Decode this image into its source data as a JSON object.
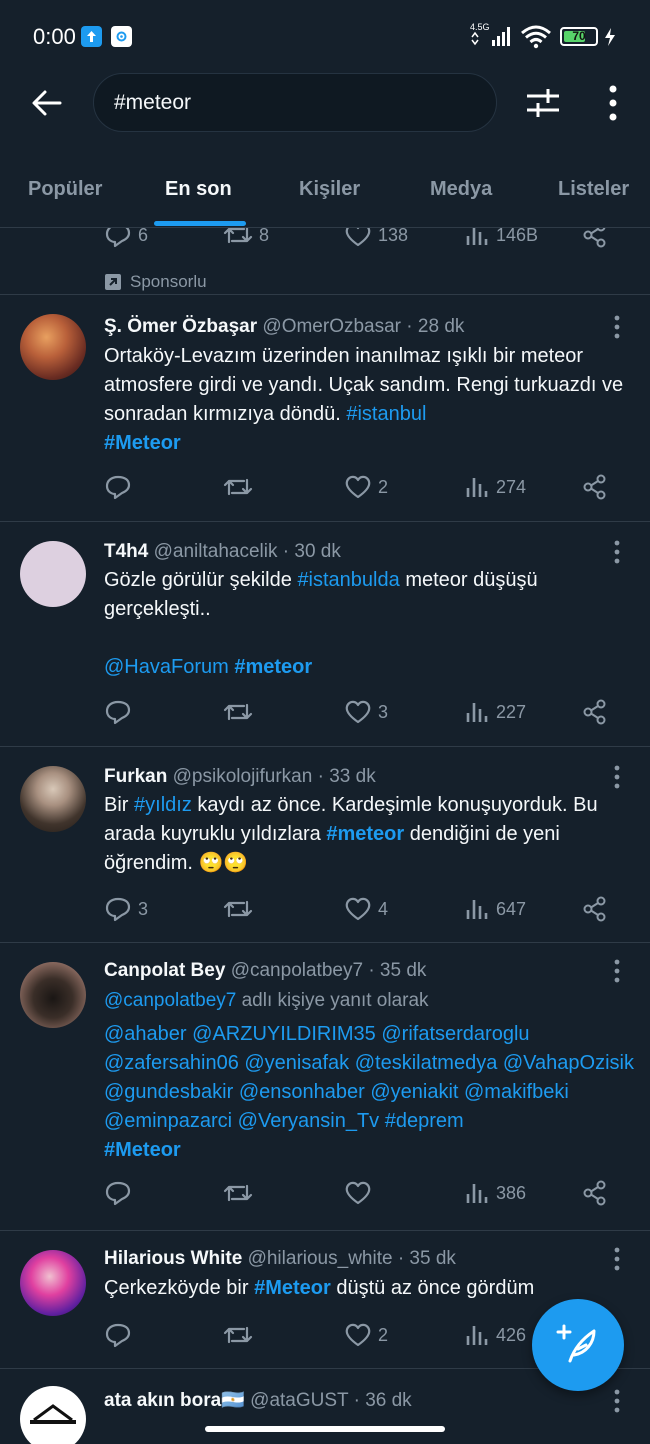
{
  "status_bar": {
    "time": "0:00",
    "network": "4.5G",
    "battery": "70",
    "battery_level": 0.7
  },
  "search": {
    "query": "#meteor"
  },
  "tabs": [
    {
      "label": "Popüler",
      "active": false
    },
    {
      "label": "En son",
      "active": true
    },
    {
      "label": "Kişiler",
      "active": false
    },
    {
      "label": "Medya",
      "active": false
    },
    {
      "label": "Listeler",
      "active": false
    }
  ],
  "top_tweet": {
    "replies": "6",
    "retweets": "8",
    "likes": "138",
    "views": "146B"
  },
  "sponsored_label": "Sponsorlu",
  "tweets": [
    {
      "name": "Ş. Ömer Özbaşar",
      "handle": "@OmerOzbasar",
      "time": "· 28 dk",
      "text_1": "Ortaköy-Levazım üzerinden inanılmaz ışıklı bir meteor atmosfere girdi ve yandı. Uçak sandım. Rengi turkuazdı ve sonradan kırmızıya döndü.",
      "link_1": "#istanbul",
      "tag_1": "#Meteor",
      "replies": "",
      "retweets": "",
      "likes": "2",
      "views": "274"
    },
    {
      "name": "T4h4",
      "handle": "@aniltahacelik",
      "time": "· 30 dk",
      "text_1": "Gözle görülür şekilde",
      "link_1": "#istanbulda",
      "text_2": "meteor düşüşü gerçekleşti..",
      "link_2": "@HavaForum",
      "tag_1": "#meteor",
      "replies": "",
      "retweets": "",
      "likes": "3",
      "views": "227"
    },
    {
      "name": "Furkan",
      "handle": "@psikolojifurkan",
      "time": "· 33 dk",
      "text_1": "Bir",
      "link_1": "#yıldız",
      "text_2": "kaydı az önce. Kardeşimle konuşuyorduk. Bu arada kuyruklu yıldızlara",
      "tag_1": "#meteor",
      "text_3": "dendiğini de yeni öğrendim.",
      "emoji": "🙄🙄",
      "replies": "3",
      "retweets": "",
      "likes": "4",
      "views": "647"
    },
    {
      "name": "Canpolat Bey",
      "handle": "@canpolatbey7",
      "time": "· 35 dk",
      "reply_to_user": "@canpolatbey7",
      "reply_to_suffix": "adlı kişiye yanıt olarak",
      "mentions": "@ahaber @ARZUYILDIRIM35 @rifatserdaroglu @zafersahin06 @yenisafak @teskilatmedya @VahapOzisik @gundesbakir @ensonhaber @yeniakit @makifbeki @eminpazarci @Veryansin_Tv #deprem",
      "tag_1": "#Meteor",
      "replies": "",
      "retweets": "",
      "likes": "",
      "views": "386"
    },
    {
      "name": "Hilarious White",
      "handle": "@hilarious_white",
      "time": "· 35 dk",
      "text_1": "Çerkezköyde bir",
      "tag_1": "#Meteor",
      "text_2": "düştü az önce gördüm",
      "replies": "",
      "retweets": "",
      "likes": "2",
      "views": "426"
    },
    {
      "name": "ata akın bora",
      "name_flag": "🇦🇷",
      "handle": "@ataGUST",
      "time": "· 36 dk"
    }
  ],
  "colors": {
    "background": "#15202b",
    "accent": "#1d9bf0",
    "muted": "#8b98a5",
    "text": "#f5f8fa"
  }
}
